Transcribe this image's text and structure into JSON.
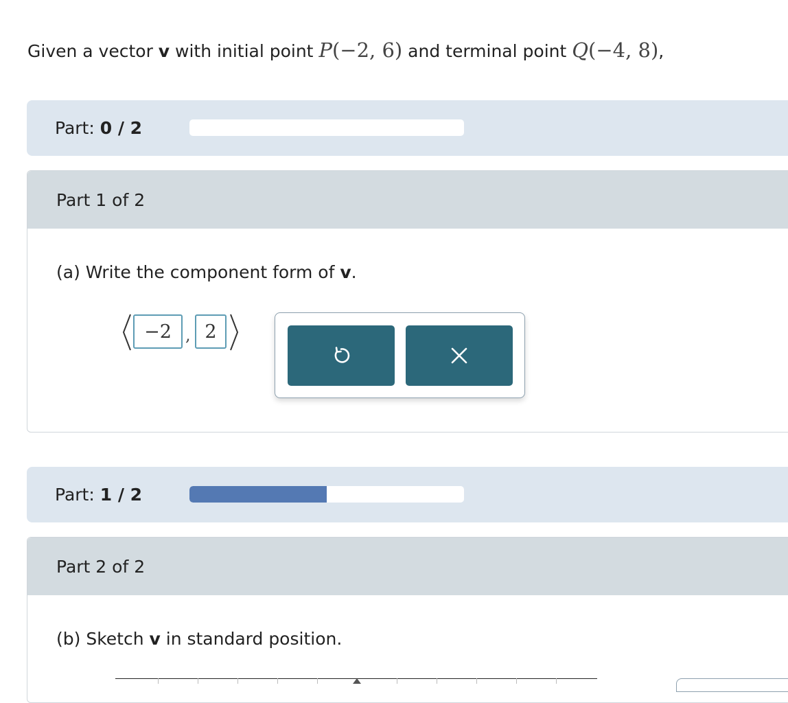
{
  "question": {
    "prefix": "Given a vector ",
    "vector_symbol": "v",
    "mid1": " with initial point ",
    "point_p": "P",
    "p_coords": "(−2, 6)",
    "mid2": " and terminal point ",
    "point_q": "Q",
    "q_coords": "(−4, 8)",
    "suffix": ","
  },
  "progress_top": {
    "label": "Part: ",
    "value": "0 / 2",
    "fraction": 0.0
  },
  "part1": {
    "header": "Part 1 of 2",
    "prompt_prefix": "(a) Write the component form of ",
    "prompt_vector": "v",
    "prompt_suffix": ".",
    "answer_x": "−2",
    "comma": ",",
    "answer_y": "2",
    "tools": {
      "undo_icon": "undo-icon",
      "clear_icon": "close-icon"
    }
  },
  "progress_mid": {
    "label": "Part: ",
    "value": "1 / 2",
    "fraction": 0.5
  },
  "part2": {
    "header": "Part 2 of 2",
    "prompt_prefix": "(b) Sketch ",
    "prompt_vector": "v",
    "prompt_suffix": " in standard position."
  },
  "colors": {
    "progress_band": "#dde6ef",
    "progress_fill": "#5479b3",
    "part_header": "#d3dbe0",
    "tool_button": "#2c687a",
    "answer_border": "#5d9cb4"
  }
}
